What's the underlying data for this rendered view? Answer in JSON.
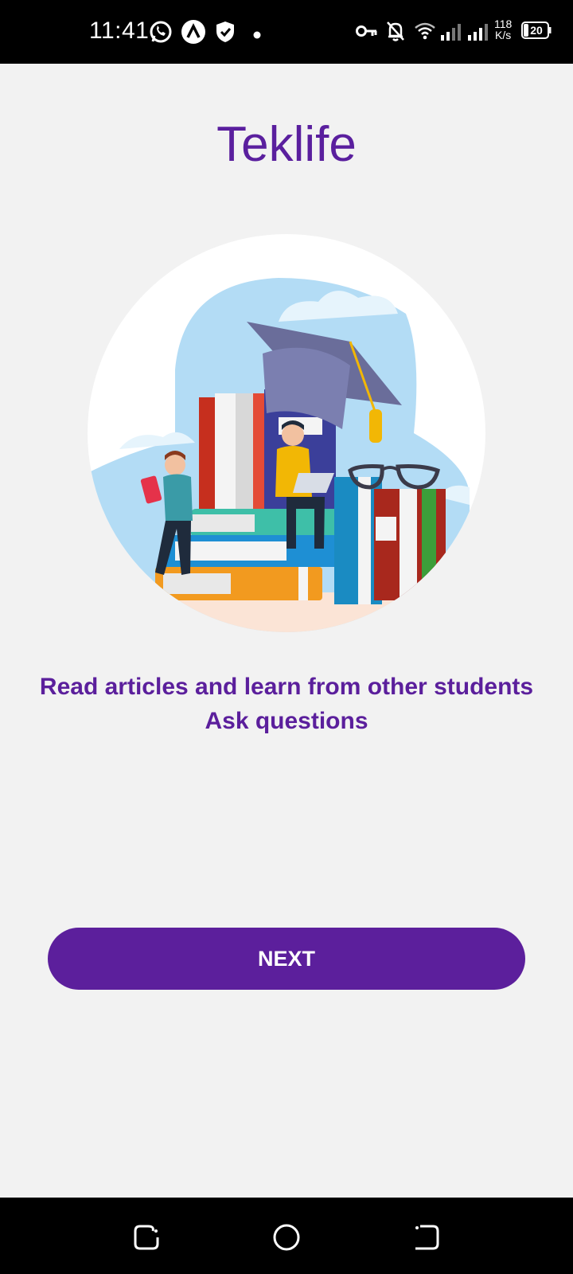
{
  "status_bar": {
    "time": "11:41",
    "network_speed_value": "118",
    "network_speed_unit": "K/s",
    "battery_level": "20",
    "icons": [
      "whatsapp-icon",
      "app-notification-icon",
      "shield-icon",
      "dot-icon",
      "vpn-key-icon",
      "bell-off-icon",
      "wifi-icon",
      "signal-icon",
      "signal-icon-2",
      "battery-icon"
    ]
  },
  "app": {
    "title": "Teklife",
    "subtitle_line1": "Read articles and learn from other students",
    "subtitle_line2": "Ask questions",
    "next_button": "NEXT"
  },
  "nav_bar": {
    "icons": [
      "recent-apps-icon",
      "home-icon",
      "back-icon"
    ]
  },
  "colors": {
    "accent": "#5c1f9c",
    "background": "#f2f2f2"
  }
}
